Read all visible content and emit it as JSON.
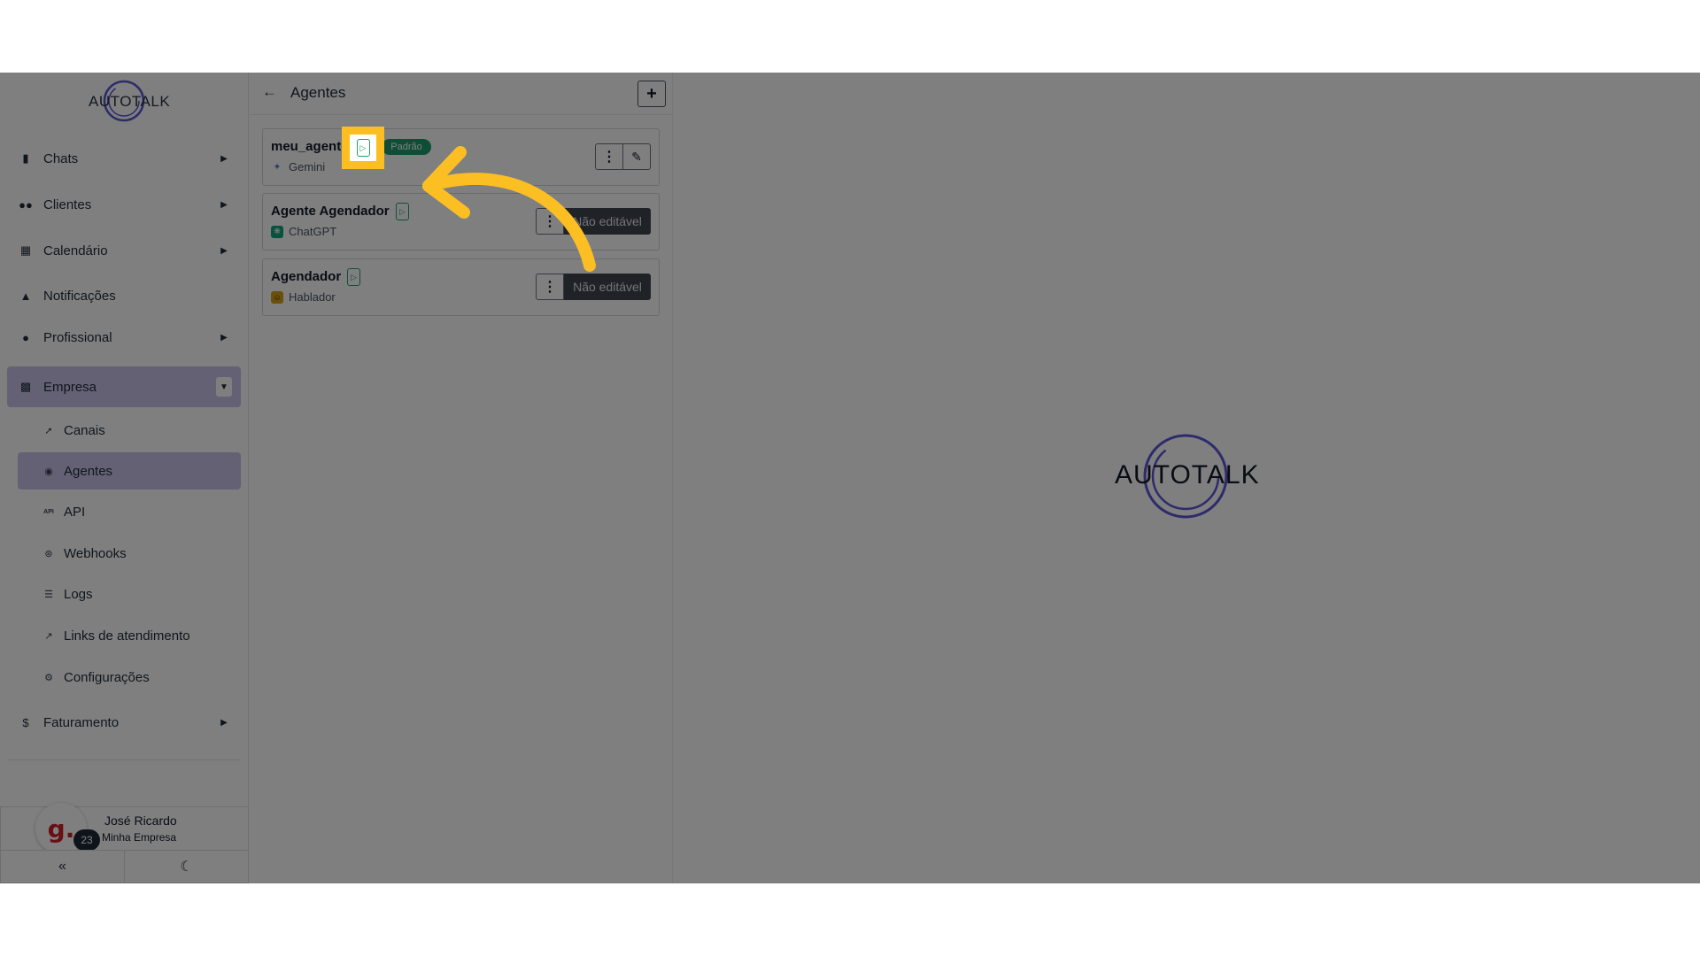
{
  "brand": {
    "logo_text": "AUTOTALK",
    "accent": "#c9c3e8",
    "ring_color": "#5b57d6",
    "annotation_color": "#fbbf24"
  },
  "sidebar": {
    "items": [
      {
        "label": "Chats",
        "icon": "chat-icon"
      },
      {
        "label": "Clientes",
        "icon": "users-icon"
      },
      {
        "label": "Calendário",
        "icon": "calendar-icon"
      },
      {
        "label": "Notificações",
        "icon": "bell-icon"
      },
      {
        "label": "Profissional",
        "icon": "user-tie-icon"
      },
      {
        "label": "Empresa",
        "icon": "building-icon"
      },
      {
        "label": "Faturamento",
        "icon": "dollar-icon"
      }
    ],
    "empresa_sub": [
      {
        "label": "Canais",
        "icon": "rocket-icon"
      },
      {
        "label": "Agentes",
        "icon": "robot-icon"
      },
      {
        "label": "API",
        "icon": "api-icon"
      },
      {
        "label": "Webhooks",
        "icon": "webhook-icon"
      },
      {
        "label": "Logs",
        "icon": "list-icon"
      },
      {
        "label": "Links de atendimento",
        "icon": "external-link-icon"
      },
      {
        "label": "Configurações",
        "icon": "gear-icon"
      }
    ],
    "user": {
      "name": "José Ricardo",
      "company": "Minha Empresa",
      "avatar_letter": "g.",
      "badge": "23"
    }
  },
  "panel": {
    "title": "Agentes",
    "agents": [
      {
        "name": "meu_agente",
        "model": "Gemini",
        "tag": "Padrão"
      },
      {
        "name": "Agente Agendador",
        "model": "ChatGPT",
        "status": "Não editável"
      },
      {
        "name": "Agendador",
        "model": "Hablador",
        "status": "Não editável"
      }
    ]
  }
}
